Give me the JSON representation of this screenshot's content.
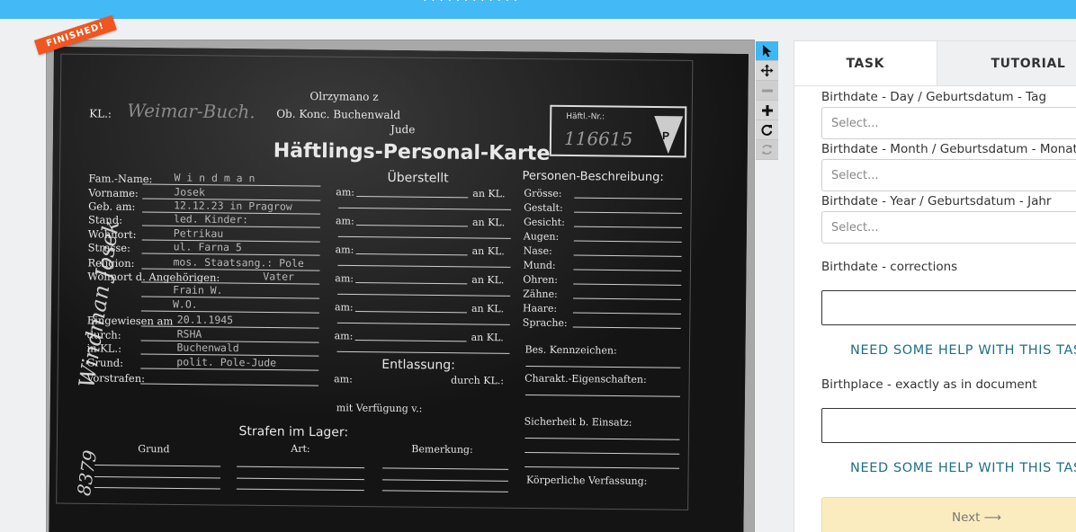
{
  "topbar": {
    "text": "· · · · · · · · · · · ·"
  },
  "badge": {
    "label": "FINISHED!"
  },
  "document": {
    "header_top": "Olrzymano z",
    "header_stamp": "Ob. Konc. Buchenwald",
    "kl_label": "KL.:",
    "kl_value": "Weimar-Buch.",
    "category": "Jude",
    "title": "Häftlings-Personal-Karte",
    "haftling_nr_label": "Häftl.-Nr.:",
    "haftling_nr": "116615",
    "triangle_letter": "P",
    "side_name": "Windman Josek",
    "side_number": "8379",
    "left_labels": [
      "Fam.-Name:",
      "Vorname:",
      "Geb. am:",
      "Stand:",
      "Wohnort:",
      "Strasse:",
      "Religion:",
      "Wohnort d. Angehörigen:",
      "",
      "",
      "Eingewiesen am",
      "durch:",
      "in KL.:",
      "Grund:",
      "Vorstrafen:"
    ],
    "left_values": [
      "W i n d m a n",
      "Josek",
      "12.12.23 in Pragrow",
      "led.  Kinder:",
      "Petrikau",
      "ul. Farna 5",
      "mos.   Staatsang.: Pole",
      "Vater",
      "Frain W.",
      "W.O.",
      "20.1.1945",
      "RSHA",
      "Buchenwald",
      "polit. Pole-Jude",
      ""
    ],
    "mid_heading": "Überstellt",
    "mid_am": "am:",
    "mid_ankl": "an KL.",
    "entlassung": "Entlassung:",
    "durch_kl": "durch KL.:",
    "mit_verfuegung": "mit Verfügung v.:",
    "right_heading": "Personen-Beschreibung:",
    "right_labels": [
      "Grösse:",
      "Gestalt:",
      "Gesicht:",
      "Augen:",
      "Nase:",
      "Mund:",
      "Ohren:",
      "Zähne:",
      "Haare:",
      "Sprache:"
    ],
    "kennzeichen": "Bes. Kennzeichen:",
    "charakt": "Charakt.-Eigenschaften:",
    "sicherheit": "Sicherheit b. Einsatz:",
    "koerper": "Körperliche Verfassung:",
    "strafen": "Strafen im Lager:",
    "strafen_cols": [
      "Grund",
      "Art:",
      "Bemerkung:"
    ]
  },
  "tools": [
    {
      "icon": "pointer-icon"
    },
    {
      "icon": "move-icon"
    },
    {
      "icon": "zoom-out-icon"
    },
    {
      "icon": "zoom-in-icon"
    },
    {
      "icon": "rotate-icon"
    },
    {
      "icon": "reset-icon"
    }
  ],
  "tabs": {
    "task": "TASK",
    "tutorial": "TUTORIAL"
  },
  "form": {
    "day_label": "Birthdate - Day / Geburtsdatum - Tag",
    "day_placeholder": "Select...",
    "month_label": "Birthdate - Month / Geburtsdatum - Monat",
    "month_placeholder": "Select...",
    "year_label": "Birthdate - Year / Geburtsdatum - Jahr",
    "year_placeholder": "Select...",
    "corrections_label": "Birthdate - corrections",
    "help_1": "NEED SOME HELP WITH THIS TASK?",
    "birthplace_label": "Birthplace - exactly as in document",
    "help_2": "NEED SOME HELP WITH THIS TASK?",
    "next_label": "Next ⟶"
  }
}
